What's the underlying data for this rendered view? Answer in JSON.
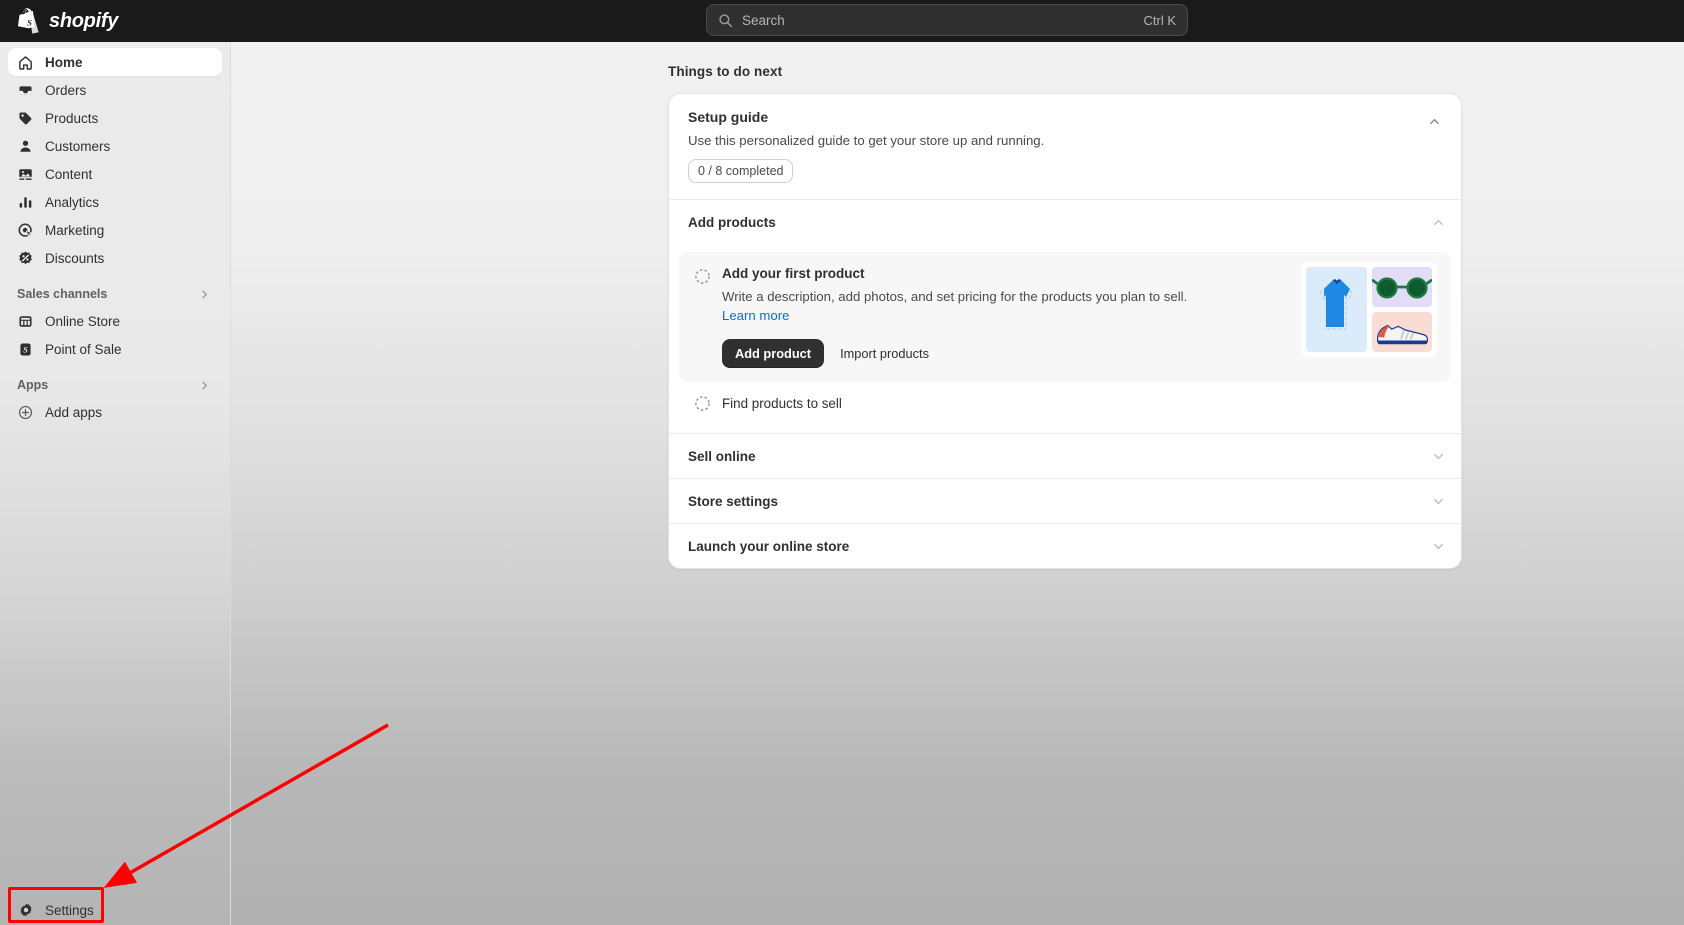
{
  "topbar": {
    "brand_name": "shopify",
    "brand_icon": "shopify-bag-logo",
    "search": {
      "icon": "search-icon",
      "placeholder": "Search",
      "shortcut": "Ctrl K",
      "value": ""
    }
  },
  "sidebar": {
    "nav_items": [
      {
        "label": "Home",
        "icon": "home-icon",
        "active": true
      },
      {
        "label": "Orders",
        "icon": "orders-icon",
        "active": false
      },
      {
        "label": "Products",
        "icon": "products-tag-icon",
        "active": false
      },
      {
        "label": "Customers",
        "icon": "customers-person-icon",
        "active": false
      },
      {
        "label": "Content",
        "icon": "content-media-icon",
        "active": false
      },
      {
        "label": "Analytics",
        "icon": "analytics-bar-chart-icon",
        "active": false
      },
      {
        "label": "Marketing",
        "icon": "marketing-target-icon",
        "active": false
      },
      {
        "label": "Discounts",
        "icon": "discounts-badge-percent-icon",
        "active": false
      }
    ],
    "sales_channels": {
      "label": "Sales channels",
      "expand_icon": "chevron-right-icon",
      "items": [
        {
          "label": "Online Store",
          "icon": "storefront-icon"
        },
        {
          "label": "Point of Sale",
          "icon": "point-of-sale-icon"
        }
      ]
    },
    "apps": {
      "label": "Apps",
      "expand_icon": "chevron-right-icon",
      "items": [
        {
          "label": "Add apps",
          "icon": "plus-circle-icon"
        }
      ]
    },
    "settings": {
      "label": "Settings",
      "icon": "gear-icon"
    }
  },
  "main": {
    "eyebrow": "Things to do next",
    "setup_guide": {
      "title": "Setup guide",
      "subtitle": "Use this personalized guide to get your store up and running.",
      "progress_badge": "0 / 8 completed",
      "toggle_icon": "chevron-up-icon"
    },
    "add_products_section": {
      "label": "Add products",
      "toggle_icon": "chevron-up-icon",
      "task": {
        "status_icon": "dashed-circle-incomplete-icon",
        "title": "Add your first product",
        "description": "Write a description, add photos, and set pricing for the products you plan to sell.",
        "learn_more": "Learn more",
        "primary_button": "Add product",
        "secondary_button": "Import products",
        "illustration": {
          "tshirt": "blue-tshirt-illustration",
          "glasses": "green-sunglasses-illustration",
          "shoe": "white-sneaker-illustration"
        }
      },
      "task2": {
        "status_icon": "dashed-circle-incomplete-icon",
        "title": "Find products to sell"
      }
    },
    "collapsed_sections": [
      {
        "label": "Sell online",
        "toggle_icon": "chevron-down-icon"
      },
      {
        "label": "Store settings",
        "toggle_icon": "chevron-down-icon"
      },
      {
        "label": "Launch your online store",
        "toggle_icon": "chevron-down-icon"
      }
    ]
  },
  "annotations": {
    "arrow_color": "#ff0000",
    "highlight_color": "#ff0000",
    "highlight_target": "Settings"
  }
}
